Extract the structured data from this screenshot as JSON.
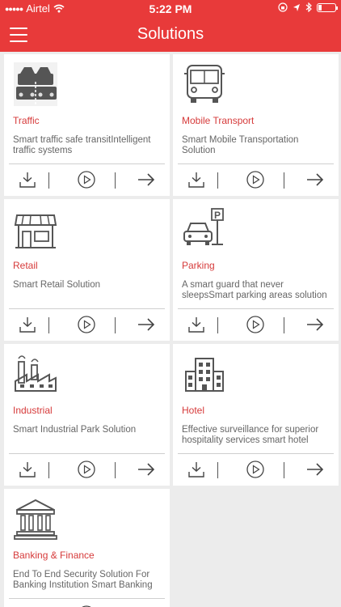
{
  "status": {
    "carrier": "Airtel",
    "time": "5:22 PM"
  },
  "header": {
    "title": "Solutions"
  },
  "cards": [
    {
      "name": "Traffic",
      "desc": "Smart traffic safe transitIntelligent traffic systems",
      "icon": "traffic-cars-icon"
    },
    {
      "name": "Mobile Transport",
      "desc": "Smart Mobile Transportation Solution",
      "icon": "bus-icon"
    },
    {
      "name": "Retail",
      "desc": "Smart Retail Solution",
      "icon": "storefront-icon"
    },
    {
      "name": "Parking",
      "desc": "A smart guard that never sleepsSmart parking areas solution",
      "icon": "parking-icon"
    },
    {
      "name": "Industrial",
      "desc": "Smart Industrial Park Solution",
      "icon": "factory-icon"
    },
    {
      "name": "Hotel",
      "desc": "Effective surveillance for superior hospitality services smart hotel",
      "icon": "hotel-building-icon"
    },
    {
      "name": "Banking & Finance",
      "desc": "End To End Security Solution For Banking Institution Smart Banking",
      "icon": "bank-icon"
    }
  ],
  "colors": {
    "accent": "#e83a3a",
    "label": "#d63a3a",
    "background": "#ececec"
  }
}
